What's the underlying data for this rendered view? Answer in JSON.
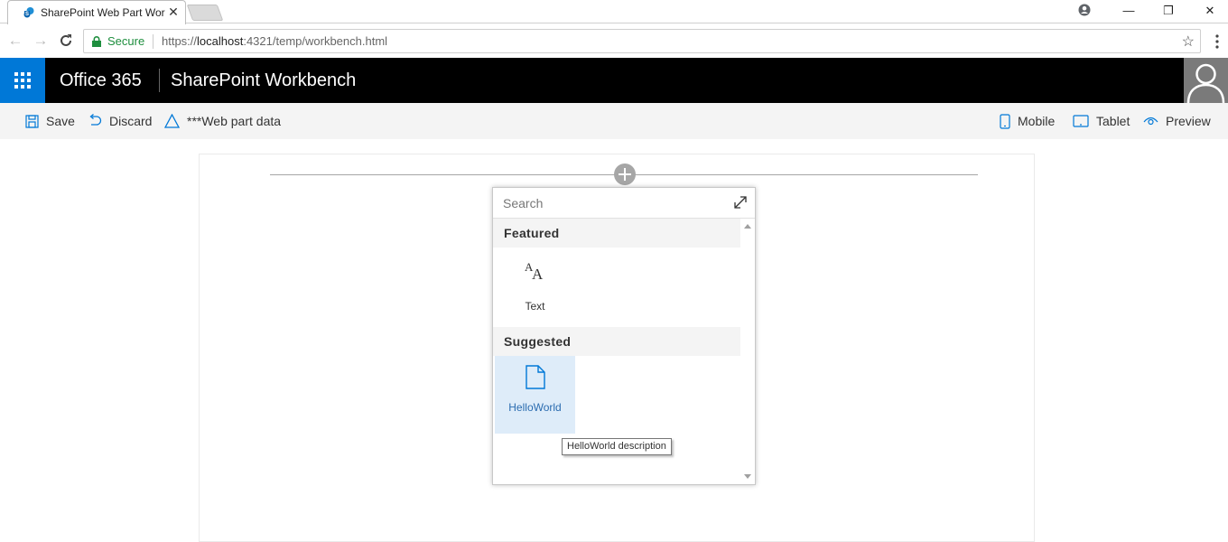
{
  "browser": {
    "tab_title": "SharePoint Web Part Workbench",
    "tab_close": "✕",
    "secure_label": "Secure",
    "url_scheme": "https://",
    "url_host": "localhost",
    "url_rest": ":4321/temp/workbench.html",
    "window_controls": {
      "minimize": "—",
      "restore": "❐",
      "close": "✕"
    }
  },
  "suite": {
    "brand": "Office 365",
    "title": "SharePoint Workbench",
    "accent_color": "#0078d7"
  },
  "commands": {
    "save": "Save",
    "discard": "Discard",
    "web_part_data": "***Web part data",
    "mobile": "Mobile",
    "tablet": "Tablet",
    "preview": "Preview"
  },
  "toolbox": {
    "search_placeholder": "Search",
    "featured_header": "Featured",
    "featured_items": [
      {
        "label": "Text",
        "icon": "text-font-icon"
      }
    ],
    "suggested_header": "Suggested",
    "suggested_items": [
      {
        "label": "HelloWorld",
        "icon": "document-icon",
        "selected": true
      }
    ],
    "tooltip": "HelloWorld description"
  }
}
